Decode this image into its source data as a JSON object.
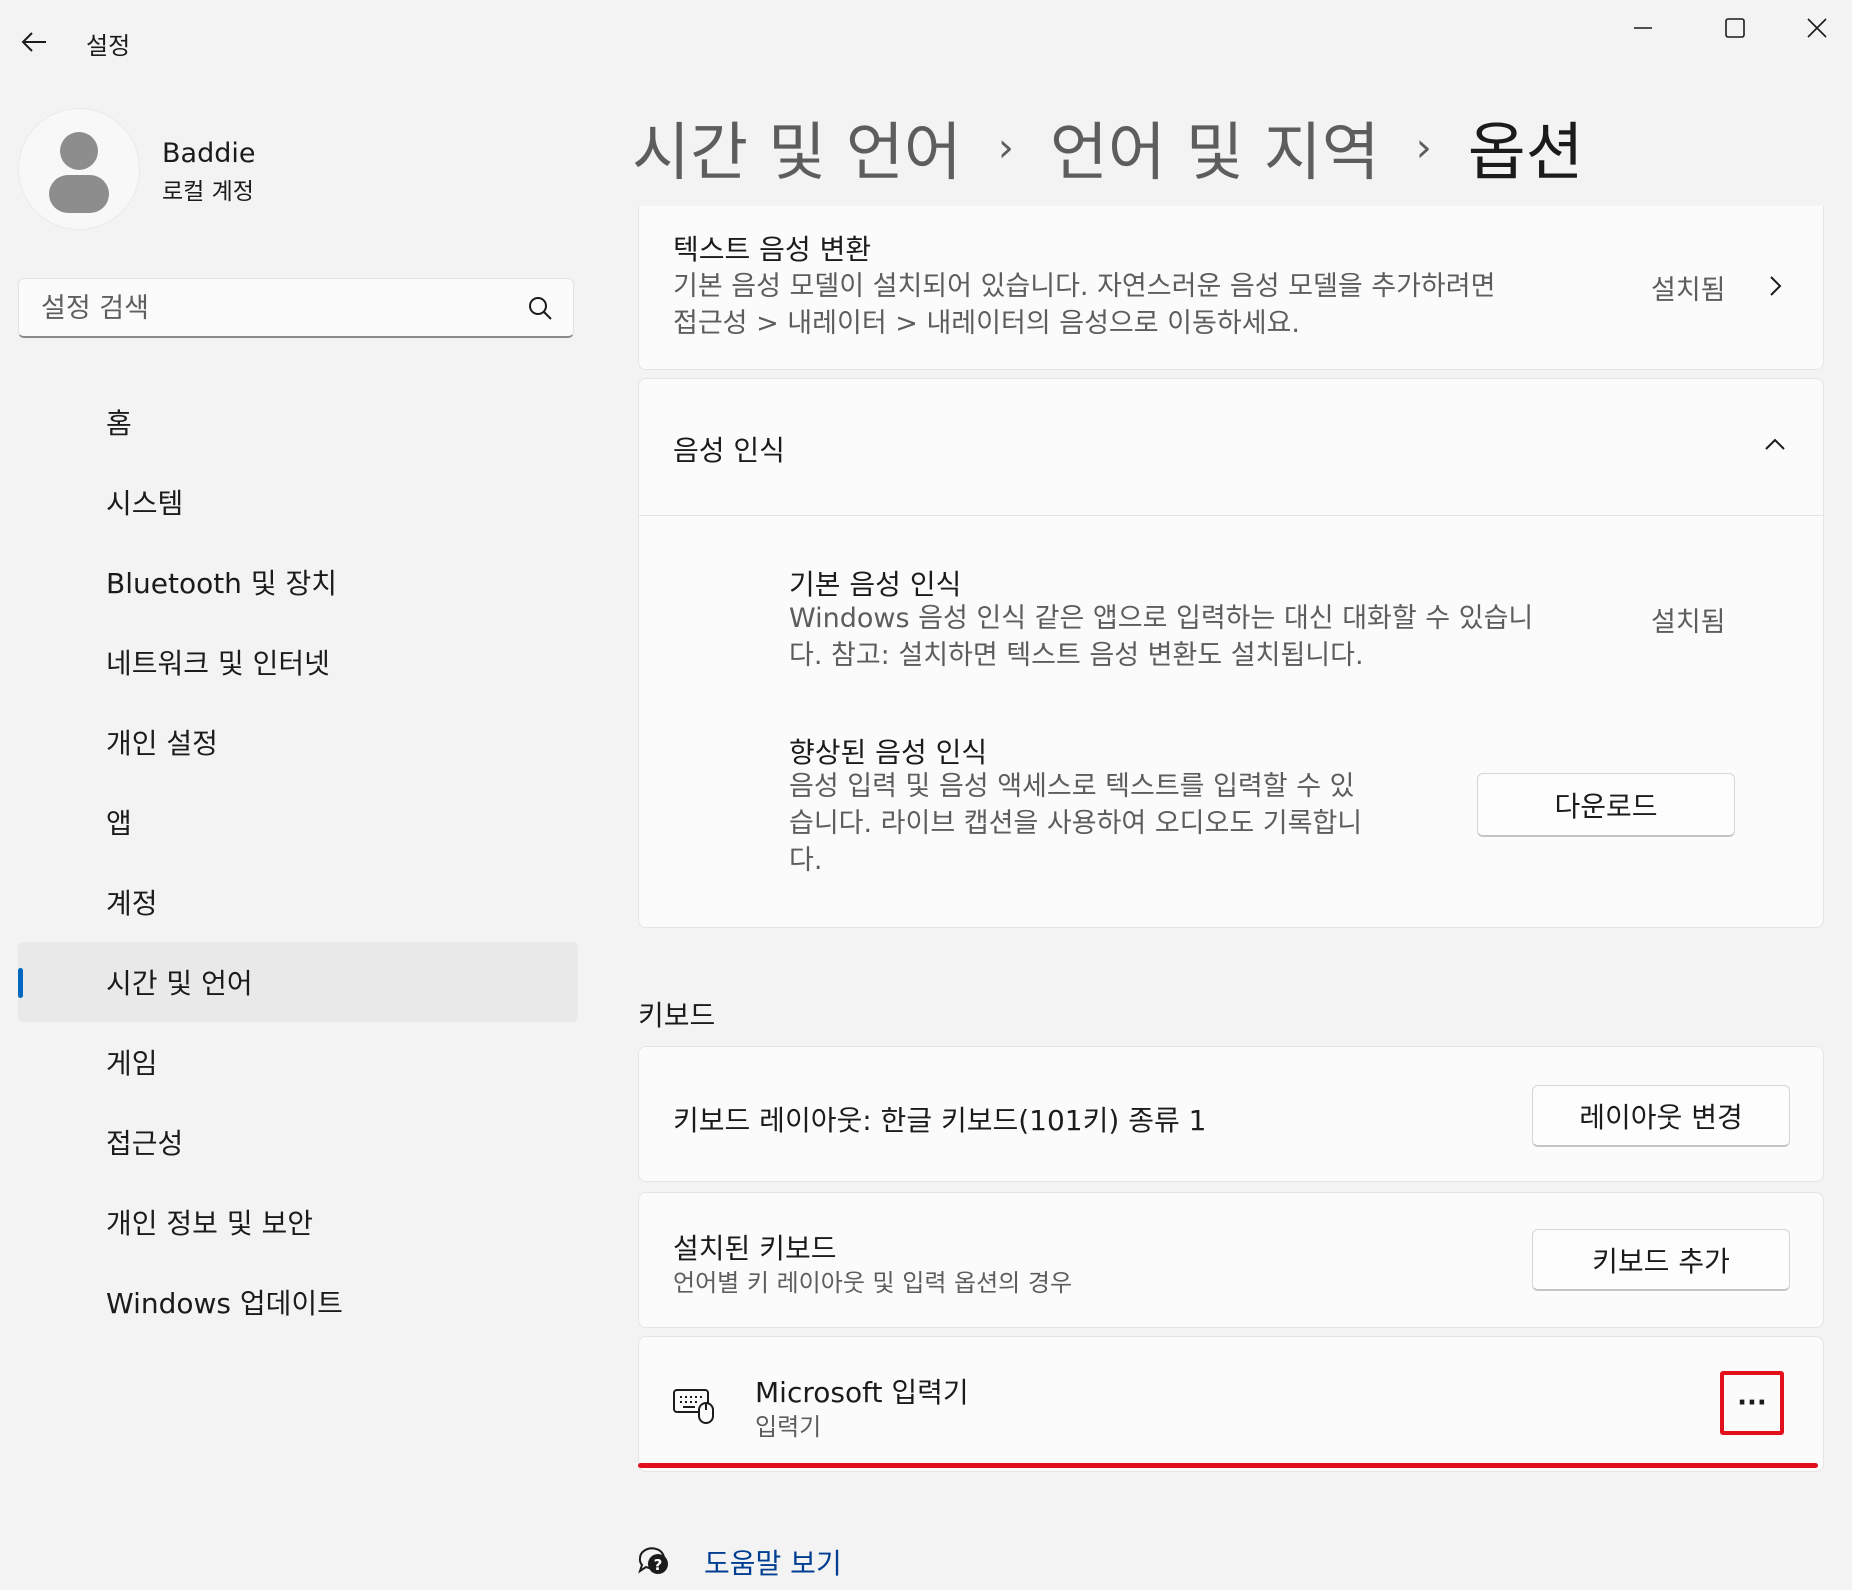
{
  "app": {
    "title": "설정"
  },
  "profile": {
    "name": "Baddie",
    "account_type": "로컬 계정"
  },
  "search": {
    "placeholder": "설정 검색"
  },
  "nav": {
    "items": [
      {
        "label": "홈"
      },
      {
        "label": "시스템"
      },
      {
        "label": "Bluetooth 및 장치"
      },
      {
        "label": "네트워크 및 인터넷"
      },
      {
        "label": "개인 설정"
      },
      {
        "label": "앱"
      },
      {
        "label": "계정"
      },
      {
        "label": "시간 및 언어",
        "selected": true
      },
      {
        "label": "게임"
      },
      {
        "label": "접근성"
      },
      {
        "label": "개인 정보 및 보안"
      },
      {
        "label": "Windows 업데이트"
      }
    ]
  },
  "breadcrumb": {
    "part1": "시간 및 언어",
    "sep": "›",
    "part2": "언어 및 지역",
    "current": "옵션"
  },
  "tts": {
    "title": "텍스트 음성 변환",
    "desc1": "기본 음성 모델이 설치되어 있습니다. 자연스러운 음성 모델을 추가하려면",
    "desc2": "접근성 > 내레이터 > 내레이터의 음성으로 이동하세요.",
    "status": "설치됨"
  },
  "speech": {
    "header": "음성 인식",
    "basic": {
      "title": "기본 음성 인식",
      "desc1": "Windows 음성 인식 같은 앱으로 입력하는 대신 대화할 수 있습니",
      "desc2": "다. 참고: 설치하면 텍스트 음성 변환도 설치됩니다.",
      "status": "설치됨"
    },
    "enhanced": {
      "title": "향상된 음성 인식",
      "desc1": "음성 입력 및 음성 액세스로 텍스트를 입력할 수 있",
      "desc2": "습니다. 라이브 캡션을 사용하여 오디오도 기록합니",
      "desc3": "다.",
      "button": "다운로드"
    }
  },
  "keyboard": {
    "section": "키보드",
    "layout_label": "키보드 레이아웃: 한글 키보드(101키) 종류 1",
    "layout_button": "레이아웃 변경",
    "installed_title": "설치된 키보드",
    "installed_desc": "언어별 키 레이아웃 및 입력 옵션의 경우",
    "add_button": "키보드 추가",
    "ime_name": "Microsoft 입력기",
    "ime_sub": "입력기",
    "more_label": "···"
  },
  "help": {
    "label": "도움말 보기"
  },
  "colors": {
    "accent": "#0067c0",
    "highlight": "#e2101a",
    "link": "#003e92"
  }
}
